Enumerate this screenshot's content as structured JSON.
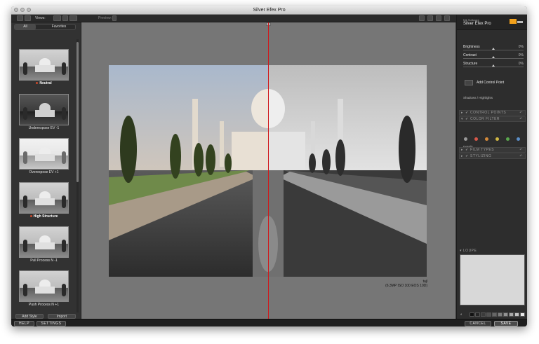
{
  "app": {
    "title": "Silver Efex Pro"
  },
  "toolbar": {
    "views_label": "Views:",
    "preview_label": "Preview:"
  },
  "left_panel": {
    "tabs": [
      "All",
      "Favorites"
    ],
    "presets": [
      {
        "label": "Neutral",
        "selected": true
      },
      {
        "label": "Underexpose EV -1",
        "selected": false
      },
      {
        "label": "Overexpose EV +1",
        "selected": false
      },
      {
        "label": "High Structure",
        "selected": true
      },
      {
        "label": "Pull Process N -1",
        "selected": false
      },
      {
        "label": "Push Process N +1",
        "selected": false
      }
    ],
    "add_style_label": "Add Style",
    "import_label": "Import"
  },
  "canvas": {
    "caption_line1": "tajl",
    "caption_line2": "(6.3MP ISO 100 EOS 10D)"
  },
  "right_panel": {
    "brand_line1": "Nik Software",
    "brand_line2": "Silver Efex Pro",
    "sliders": [
      {
        "label": "Brightness",
        "value": "0%"
      },
      {
        "label": "Contrast",
        "value": "0%"
      },
      {
        "label": "Structure",
        "value": "0%"
      }
    ],
    "add_control_point_label": "Add Control Point",
    "shadows_highlights_label": "Shadows / Highlights",
    "sections": {
      "control_points": "CONTROL POINTS",
      "color_filter": "COLOR FILTER",
      "details": "Details",
      "film_types": "FILM TYPES",
      "stylizing": "STYLIZING"
    },
    "loupe_label": "LOUPE",
    "filter_colors": [
      "#9a9a9a",
      "#d8584a",
      "#d58a3a",
      "#d2b844",
      "#5aa84e",
      "#5b8fc9"
    ]
  },
  "bottom": {
    "help_label": "HELP",
    "settings_label": "SETTINGS",
    "cancel_label": "CANCEL",
    "save_label": "SAVE"
  }
}
